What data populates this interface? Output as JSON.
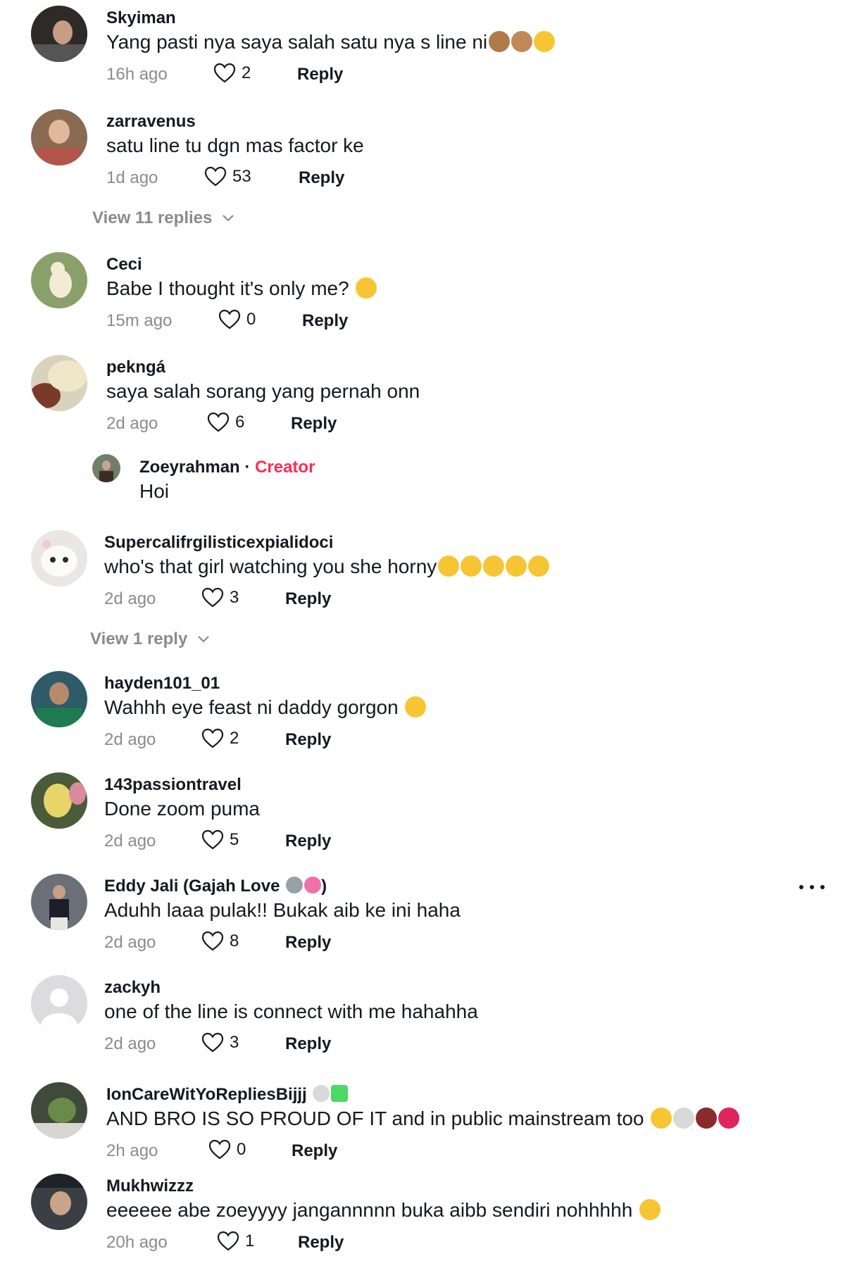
{
  "comments": [
    {
      "user": "Skyiman",
      "text": "Yang pasti nya saya salah satu nya s line ni",
      "emojis": [
        "see-no-evil-monkey",
        "monkey",
        "rofl"
      ],
      "time": "16h ago",
      "likes": "2",
      "reply": "Reply"
    },
    {
      "user": "zarravenus",
      "text": "satu line tu dgn mas factor ke",
      "emojis": [],
      "time": "1d ago",
      "likes": "53",
      "reply": "Reply",
      "view_replies": "View 11 replies"
    },
    {
      "user": "Ceci",
      "text": "Babe I thought it's only me? ",
      "emojis": [
        "pensive-face"
      ],
      "time": "15m ago",
      "likes": "0",
      "reply": "Reply"
    },
    {
      "user": "pekngá",
      "text": "saya salah sorang yang pernah onn",
      "emojis": [],
      "time": "2d ago",
      "likes": "6",
      "reply": "Reply",
      "creator_reply": {
        "user": "Zoeyrahman",
        "separator": "·",
        "badge": "Creator",
        "text": "Hoi"
      }
    },
    {
      "user": "Supercalifrgilisticexpialidoci",
      "text": "who's that girl watching you she horny",
      "emojis": [
        "joy",
        "rofl",
        "joy",
        "rofl",
        "joy"
      ],
      "time": "2d ago",
      "likes": "3",
      "reply": "Reply",
      "view_replies": "View 1 reply"
    },
    {
      "user": "hayden101_01",
      "text": "Wahhh eye feast ni daddy gorgon ",
      "emojis": [
        "joy"
      ],
      "time": "2d ago",
      "likes": "2",
      "reply": "Reply"
    },
    {
      "user": "143passiontravel",
      "text": "Done zoom puma",
      "emojis": [],
      "time": "2d ago",
      "likes": "5",
      "reply": "Reply"
    },
    {
      "user": "Eddy Jali (Gajah Love ",
      "user_suffix": ")",
      "user_emojis": [
        "elephant",
        "two-hearts"
      ],
      "text": "Aduhh laaa pulak!! Bukak aib ke ini haha",
      "emojis": [],
      "time": "2d ago",
      "likes": "8",
      "reply": "Reply"
    },
    {
      "user": "zackyh",
      "text": "one of the line is connect with me hahahha",
      "emojis": [],
      "time": "2d ago",
      "likes": "3",
      "reply": "Reply"
    },
    {
      "user": "IonCareWitYoRepliesBijjj ",
      "user_emojis": [
        "skull",
        "water-pistol"
      ],
      "text": "AND BRO IS SO PROUD OF IT and in public mainstream too ",
      "emojis": [
        "smiley",
        "skull",
        "wilted-rose",
        "broken-heart"
      ],
      "time": "2h ago",
      "likes": "0",
      "reply": "Reply"
    },
    {
      "user": "Mukhwizzz",
      "text": "eeeeee abe zoeyyyy jangannnnn buka aibb sendiri nohhhhh ",
      "emojis": [
        "loudly-crying"
      ],
      "time": "20h ago",
      "likes": "1",
      "reply": "Reply"
    }
  ],
  "colors": {
    "creator": "#fe2c55",
    "muted": "#8a8b91",
    "text": "#161823"
  }
}
